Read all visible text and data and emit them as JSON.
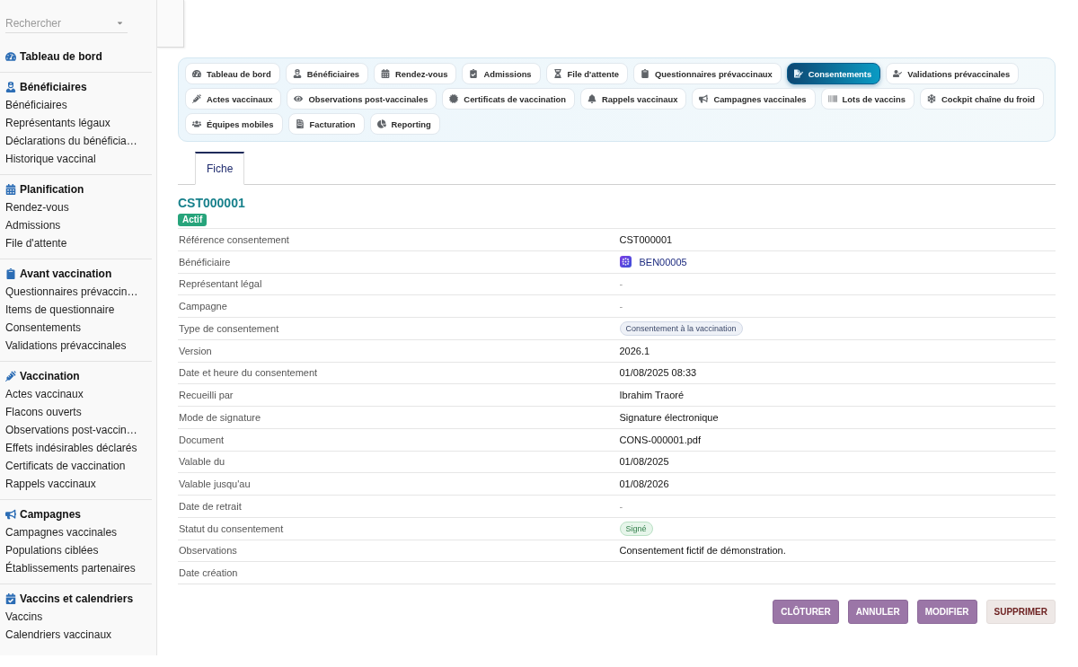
{
  "sidebar": {
    "search": {
      "placeholder": "Rechercher"
    },
    "sections": [
      {
        "title": "Tableau de bord"
      },
      {
        "title": "Bénéficiaires",
        "items": [
          "Bénéficiaires",
          "Représentants légaux",
          "Déclarations du bénéficia…",
          "Historique vaccinal"
        ]
      },
      {
        "title": "Planification",
        "items": [
          "Rendez-vous",
          "Admissions",
          "File d'attente"
        ]
      },
      {
        "title": "Avant vaccination",
        "items": [
          "Questionnaires prévaccin…",
          "Items de questionnaire",
          "Consentements",
          "Validations prévaccinales"
        ]
      },
      {
        "title": "Vaccination",
        "items": [
          "Actes vaccinaux",
          "Flacons ouverts",
          "Observations post-vaccin…",
          "Effets indésirables déclarés",
          "Certificats de vaccination",
          "Rappels vaccinaux"
        ]
      },
      {
        "title": "Campagnes",
        "items": [
          "Campagnes vaccinales",
          "Populations ciblées",
          "Établissements partenaires"
        ]
      },
      {
        "title": "Vaccins et calendriers",
        "items": [
          "Vaccins",
          "Calendriers vaccinaux"
        ]
      }
    ]
  },
  "module_nav": {
    "items": [
      {
        "label": "Tableau de bord",
        "selected": false
      },
      {
        "label": "Bénéficiaires",
        "selected": false
      },
      {
        "label": "Rendez-vous",
        "selected": false
      },
      {
        "label": "Admissions",
        "selected": false
      },
      {
        "label": "File d'attente",
        "selected": false
      },
      {
        "label": "Questionnaires prévaccinaux",
        "selected": false
      },
      {
        "label": "Consentements",
        "selected": true
      },
      {
        "label": "Validations prévaccinales",
        "selected": false
      },
      {
        "label": "Actes vaccinaux",
        "selected": false
      },
      {
        "label": "Observations post-vaccinales",
        "selected": false
      },
      {
        "label": "Certificats de vaccination",
        "selected": false
      },
      {
        "label": "Rappels vaccinaux",
        "selected": false
      },
      {
        "label": "Campagnes vaccinales",
        "selected": false
      },
      {
        "label": "Lots de vaccins",
        "selected": false
      },
      {
        "label": "Cockpit chaîne du froid",
        "selected": false
      },
      {
        "label": "Équipes mobiles",
        "selected": false
      },
      {
        "label": "Facturation",
        "selected": false
      },
      {
        "label": "Reporting",
        "selected": false
      }
    ]
  },
  "tabs": [
    {
      "label": "Fiche",
      "selected": true
    }
  ],
  "record": {
    "title": "CST000001",
    "status": "Actif",
    "fields": [
      {
        "label": "Référence consentement",
        "kind": "text",
        "value": "CST000001"
      },
      {
        "label": "Bénéficiaire",
        "kind": "link",
        "value": "BEN00005"
      },
      {
        "label": "Représentant légal",
        "kind": "muted",
        "value": "-"
      },
      {
        "label": "Campagne",
        "kind": "muted",
        "value": "-"
      },
      {
        "label": "Type de consentement",
        "kind": "tag",
        "value": "Consentement à la vaccination"
      },
      {
        "label": "Version",
        "kind": "text",
        "value": "2026.1"
      },
      {
        "label": "Date et heure du consentement",
        "kind": "text",
        "value": "01/08/2025 08:33"
      },
      {
        "label": "Recueilli par",
        "kind": "text",
        "value": "Ibrahim Traoré"
      },
      {
        "label": "Mode de signature",
        "kind": "text",
        "value": "Signature électronique"
      },
      {
        "label": "Document",
        "kind": "text",
        "value": "CONS-000001.pdf"
      },
      {
        "label": "Valable du",
        "kind": "text",
        "value": "01/08/2025"
      },
      {
        "label": "Valable jusqu'au",
        "kind": "text",
        "value": "01/08/2026"
      },
      {
        "label": "Date de retrait",
        "kind": "muted",
        "value": "-"
      },
      {
        "label": "Statut du consentement",
        "kind": "status",
        "value": "Signé"
      },
      {
        "label": "Observations",
        "kind": "text",
        "value": "Consentement fictif de démonstration."
      },
      {
        "label": "Date création"
      }
    ]
  },
  "actions": [
    {
      "label": "CLÔTURER",
      "kind": "primary"
    },
    {
      "label": "ANNULER",
      "kind": "primary"
    },
    {
      "label": "MODIFIER",
      "kind": "primary"
    },
    {
      "label": "SUPPRIMER",
      "kind": "danger"
    }
  ]
}
